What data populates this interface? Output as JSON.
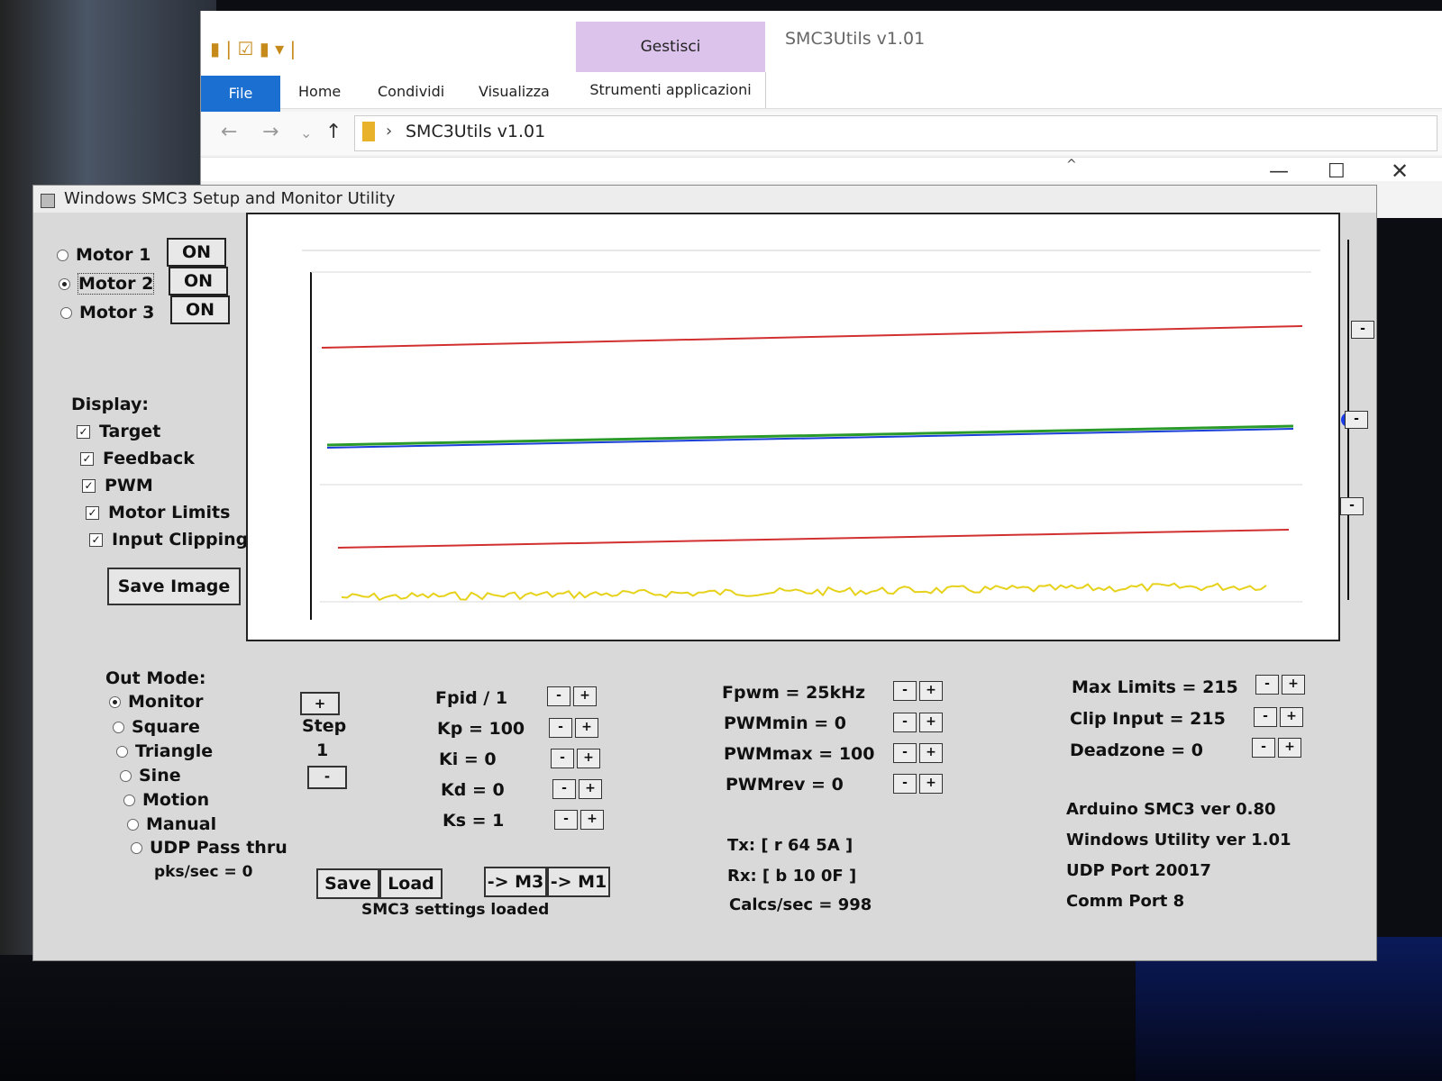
{
  "explorer": {
    "quick_access": "▮ | ☑ ▮ ▾ |",
    "context_tab": "Gestisci",
    "title": "SMC3Utils v1.01",
    "tabs": {
      "file": "File",
      "home": "Home",
      "condividi": "Condividi",
      "visualizza": "Visualizza",
      "strumenti": "Strumenti applicazioni"
    },
    "nav": {
      "back": "←",
      "forward": "→",
      "recent": "⌄",
      "up": "↑"
    },
    "path": "SMC3Utils v1.01",
    "path_sep": "›",
    "sort_caret": "^",
    "window": {
      "min": "—",
      "max": "☐",
      "close": "✕"
    }
  },
  "smc": {
    "title": "Windows SMC3 Setup and Monitor Utility",
    "motors": [
      {
        "label": "Motor 1",
        "state": "ON",
        "selected": false
      },
      {
        "label": "Motor 2",
        "state": "ON",
        "selected": true
      },
      {
        "label": "Motor 3",
        "state": "ON",
        "selected": false
      }
    ],
    "display": {
      "heading": "Display:",
      "options": [
        {
          "label": "Target",
          "checked": true
        },
        {
          "label": "Feedback",
          "checked": true
        },
        {
          "label": "PWM",
          "checked": true
        },
        {
          "label": "Motor Limits",
          "checked": true
        },
        {
          "label": "Input Clipping",
          "checked": true
        }
      ],
      "check_mark": "✓"
    },
    "save_image": "Save Image",
    "out_mode": {
      "heading": "Out Mode:",
      "options": [
        {
          "label": "Monitor",
          "selected": true
        },
        {
          "label": "Square",
          "selected": false
        },
        {
          "label": "Triangle",
          "selected": false
        },
        {
          "label": "Sine",
          "selected": false
        },
        {
          "label": "Motion",
          "selected": false
        },
        {
          "label": "Manual",
          "selected": false
        },
        {
          "label": "UDP Pass thru",
          "selected": false
        }
      ],
      "pks": "pks/sec = 0"
    },
    "step": {
      "plus": "+",
      "label": "Step",
      "value": "1",
      "minus": "-"
    },
    "pid": [
      {
        "label": "Fpid / 1"
      },
      {
        "label": "Kp = 100"
      },
      {
        "label": "Ki = 0"
      },
      {
        "label": "Kd = 0"
      },
      {
        "label": "Ks = 1"
      }
    ],
    "pwm": [
      {
        "label": "Fpwm = 25kHz"
      },
      {
        "label": "PWMmin = 0"
      },
      {
        "label": "PWMmax = 100"
      },
      {
        "label": "PWMrev = 0"
      }
    ],
    "limits": [
      {
        "label": "Max Limits = 215"
      },
      {
        "label": "Clip Input = 215"
      },
      {
        "label": "Deadzone = 0"
      }
    ],
    "pm": {
      "minus": "-",
      "plus": "+"
    },
    "info": {
      "arduino": "Arduino SMC3 ver 0.80",
      "utility": "Windows Utility ver 1.01",
      "udp": "UDP Port 20017",
      "comm": "Comm Port 8"
    },
    "comm": {
      "tx": "Tx: [ r 64 5A ]",
      "rx": "Rx: [ b 10 0F ]",
      "calcs": "Calcs/sec = 998"
    },
    "buttons": {
      "save": "Save",
      "load": "Load",
      "m3": "-> M3",
      "m1": "-> M1"
    },
    "status": "SMC3 settings loaded",
    "colors": {
      "motor_limit": "#d23030",
      "target": "#2a9a2a",
      "feedback": "#1a3fd8",
      "pwm": "#e6d21a",
      "slider_thumb": "#1a3be8"
    }
  }
}
